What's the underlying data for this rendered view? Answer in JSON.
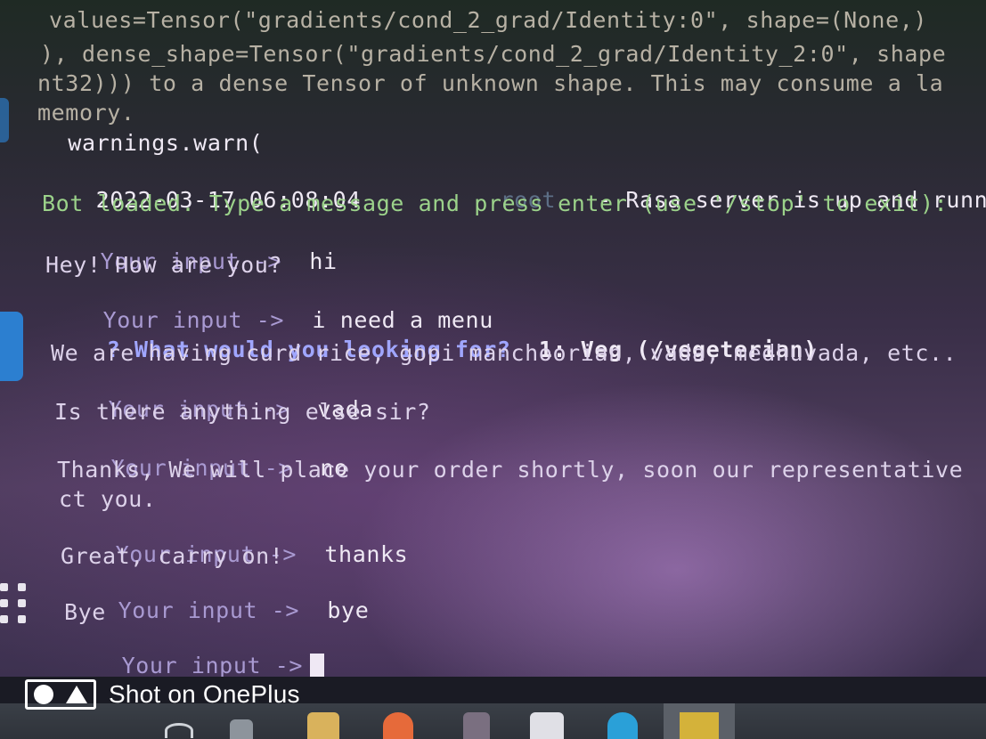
{
  "terminal": {
    "lines": [
      "values=Tensor(\"gradients/cond_2_grad/Identity:0\", shape=(None,)",
      "), dense_shape=Tensor(\"gradients/cond_2_grad/Identity_2:0\", shape",
      "nt32))) to a dense Tensor of unknown shape. This may consume a la",
      "memory.",
      "  warnings.warn("
    ],
    "log_timestamp": "2022-03-17 06:08:04",
    "log_source": "root",
    "log_message": "- Rasa server is up and runnin",
    "bot_loaded": "Bot loaded. Type a message and press enter (use '/stop' to exit):",
    "prompt_label": "Your input ->",
    "conversation": {
      "input_1": "hi",
      "reply_1": "Hey! How are you?",
      "input_2": "i need a menu",
      "question_mark": "?",
      "question_text": "What would you looking for?",
      "option_1": "1: Veg (/vegeterian)",
      "reply_2": "We are having curd rice, gopi manchoorian, vada, medhuvada, etc..",
      "input_3": "vada",
      "reply_3": "Is there anything else sir?",
      "input_4": "no",
      "reply_4a": "Thanks, We will place your order shortly, soon our representative",
      "reply_4b": "ct you.",
      "input_5": "thanks",
      "reply_5": "Great, carry on!",
      "input_6": "bye",
      "reply_6": "Bye"
    }
  },
  "watermark": {
    "text": "Shot on OnePlus"
  },
  "icons": {
    "left_top": "app-icon",
    "left_vscode": "vscode-icon",
    "left_grid": "app-grid-icon"
  }
}
